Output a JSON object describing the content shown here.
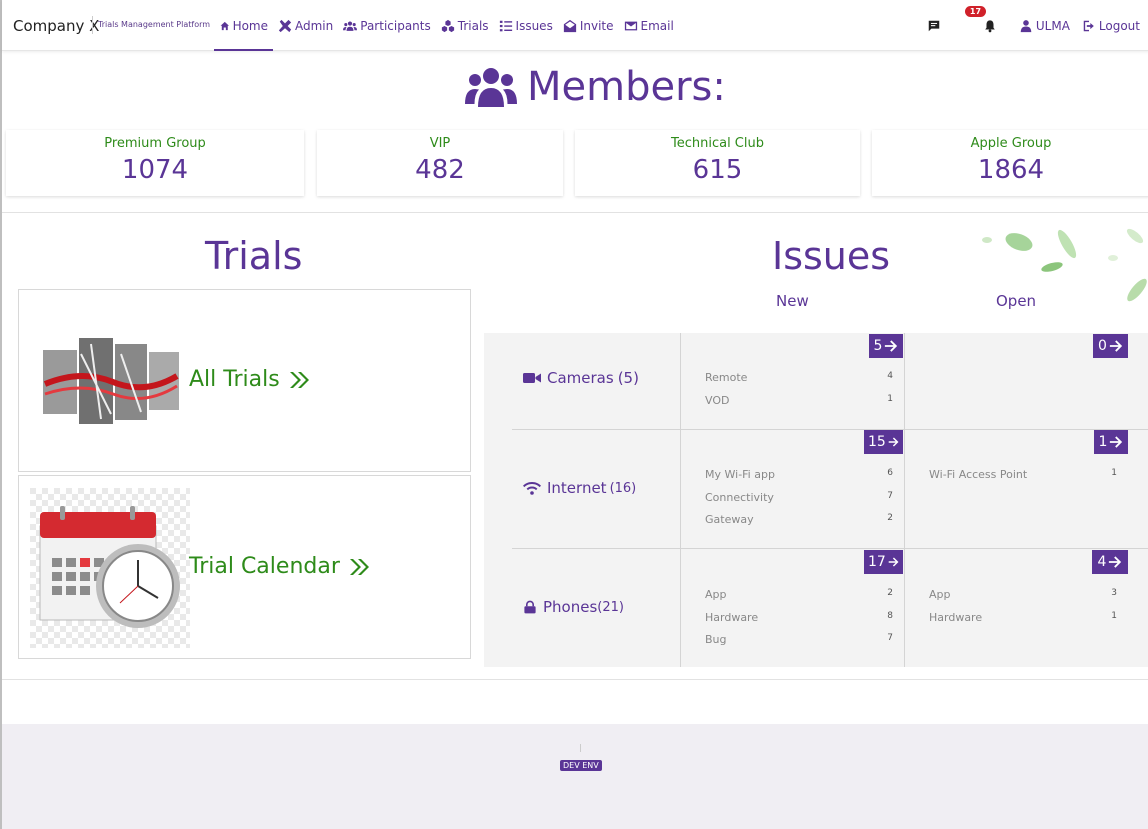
{
  "navbar": {
    "brand": "Company X",
    "brand_sub": "Trials Management Platform",
    "items": [
      {
        "label": "Home",
        "icon": "home-icon"
      },
      {
        "label": "Admin",
        "icon": "tools-icon"
      },
      {
        "label": "Participants",
        "icon": "users-icon"
      },
      {
        "label": "Trials",
        "icon": "cubes-icon"
      },
      {
        "label": "Issues",
        "icon": "list-icon"
      },
      {
        "label": "Invite",
        "icon": "envelope-open-icon"
      },
      {
        "label": "Email",
        "icon": "envelope-icon"
      }
    ],
    "notifications_count": "17",
    "user": "ULMA",
    "logout": "Logout"
  },
  "members": {
    "title": "Members:",
    "groups": [
      {
        "label": "Premium Group",
        "value": "1074"
      },
      {
        "label": "VIP",
        "value": "482"
      },
      {
        "label": "Technical Club",
        "value": "615"
      },
      {
        "label": "Apple Group",
        "value": "1864"
      }
    ]
  },
  "trials": {
    "title": "Trials",
    "all_trials": "All Trials",
    "trial_calendar": "Trial Calendar"
  },
  "issues": {
    "title": "Issues",
    "col_new": "New",
    "col_open": "Open",
    "categories": [
      {
        "name": "Cameras",
        "count": "(5)",
        "new_total": "5",
        "open_total": "0",
        "new_items": [
          {
            "label": "Remote",
            "n": "4"
          },
          {
            "label": "VOD",
            "n": "1"
          }
        ],
        "open_items": []
      },
      {
        "name": "Internet",
        "count": "(16)",
        "new_total": "15",
        "open_total": "1",
        "new_items": [
          {
            "label": "My Wi-Fi app",
            "n": "6"
          },
          {
            "label": "Connectivity",
            "n": "7"
          },
          {
            "label": "Gateway",
            "n": "2"
          }
        ],
        "open_items": [
          {
            "label": "Wi-Fi Access Point",
            "n": "1"
          }
        ]
      },
      {
        "name": "Phones",
        "count": "(21)",
        "new_total": "17",
        "open_total": "4",
        "new_items": [
          {
            "label": "App",
            "n": "2"
          },
          {
            "label": "Hardware",
            "n": "8"
          },
          {
            "label": "Bug",
            "n": "7"
          }
        ],
        "open_items": [
          {
            "label": "App",
            "n": "3"
          },
          {
            "label": "Hardware",
            "n": "1"
          }
        ]
      }
    ]
  },
  "footer": {
    "env": "DEV ENV"
  },
  "colors": {
    "brand_purple": "#5a3596",
    "green": "#2e8b1a",
    "alert_red": "#d0212a"
  }
}
